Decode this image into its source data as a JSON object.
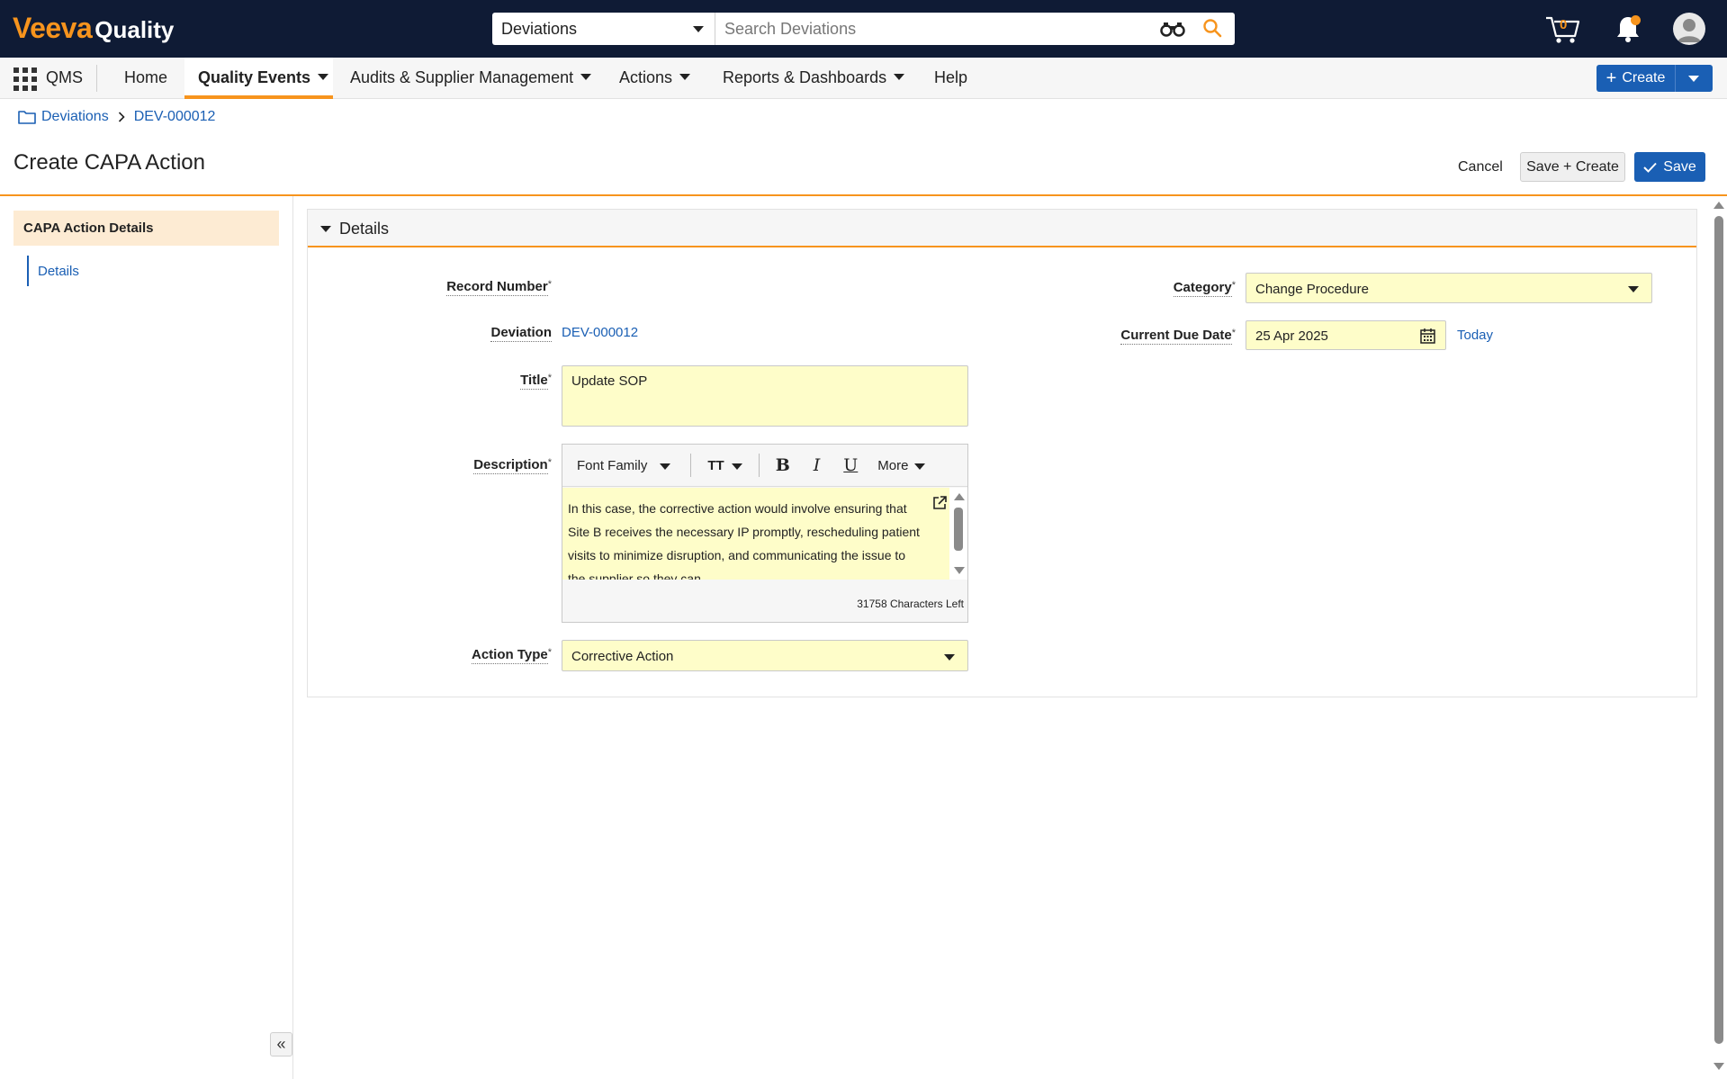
{
  "brand": {
    "name_part1": "Veeva",
    "name_part2": "Quality"
  },
  "search": {
    "scope": "Deviations",
    "placeholder": "Search Deviations"
  },
  "cart": {
    "count": "0"
  },
  "nav": {
    "app": "QMS",
    "items": [
      {
        "label": "Home"
      },
      {
        "label": "Quality Events"
      },
      {
        "label": "Audits & Supplier Management"
      },
      {
        "label": "Actions"
      },
      {
        "label": "Reports & Dashboards"
      },
      {
        "label": "Help"
      }
    ],
    "create_label": "Create"
  },
  "breadcrumb": {
    "parent": "Deviations",
    "current": "DEV-000012"
  },
  "header": {
    "title": "Create CAPA Action",
    "cancel": "Cancel",
    "save_create": "Save + Create",
    "save": "Save"
  },
  "left_panel": {
    "section": "CAPA Action Details",
    "link": "Details"
  },
  "details": {
    "section_title": "Details",
    "record_number_label": "Record Number",
    "deviation_label": "Deviation",
    "deviation_value": "DEV-000012",
    "title_label": "Title",
    "title_value": "Update SOP",
    "description_label": "Description",
    "description_value": "In this case, the corrective action would involve ensuring that Site B receives the necessary IP promptly, rescheduling patient visits to minimize disruption, and communicating the issue to the supplier so they can",
    "editor": {
      "font_family": "Font Family",
      "size_icon": "TT",
      "bold": "B",
      "italic": "I",
      "underline": "U",
      "more": "More",
      "chars_left": "31758 Characters Left"
    },
    "action_type_label": "Action Type",
    "action_type_value": "Corrective Action",
    "category_label": "Category",
    "category_value": "Change Procedure",
    "due_date_label": "Current Due Date",
    "due_date_value": "25 Apr 2025",
    "today_link": "Today",
    "required_marker": "*"
  },
  "colors": {
    "topbar": "#0f1b35",
    "accent": "#f7941d",
    "primary": "#1a5fb4",
    "field_bg": "#fefdc9"
  }
}
